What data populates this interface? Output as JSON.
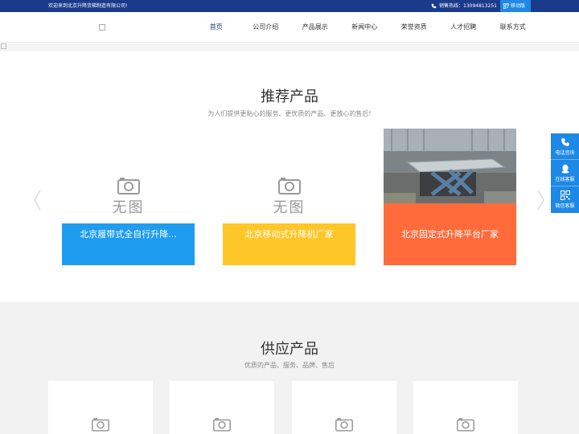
{
  "topbar": {
    "welcome": "欢迎来到北京升降货梯制造有限公司!",
    "phone_label": "销售热线：13094813251",
    "mobile_label": "移动版"
  },
  "nav": {
    "items": [
      {
        "label": "首页"
      },
      {
        "label": "公司介绍"
      },
      {
        "label": "产品展示"
      },
      {
        "label": "新闻中心"
      },
      {
        "label": "荣誉资质"
      },
      {
        "label": "人才招聘"
      },
      {
        "label": "联系方式"
      }
    ]
  },
  "recommend": {
    "title": "推荐产品",
    "subtitle": "为人们提供更贴心的服务、更优质的产品、更放心的售后!",
    "no_image_text": "无图",
    "cards": [
      {
        "label": "北京履带式全自行升降...",
        "color": "#1e9cf0"
      },
      {
        "label": "北京移动式升降机厂家",
        "color": "#ffc627"
      },
      {
        "label": "北京固定式升降平台厂家",
        "color": "#ff6b3b"
      }
    ]
  },
  "supply": {
    "title": "供应产品",
    "subtitle": "优质的产品、服务、品牌、售后"
  },
  "sidebar": {
    "items": [
      {
        "label": "电话咨询",
        "icon": "phone-icon"
      },
      {
        "label": "在线客服",
        "icon": "qq-icon"
      },
      {
        "label": "微信客服",
        "icon": "qrcode-icon"
      }
    ]
  }
}
